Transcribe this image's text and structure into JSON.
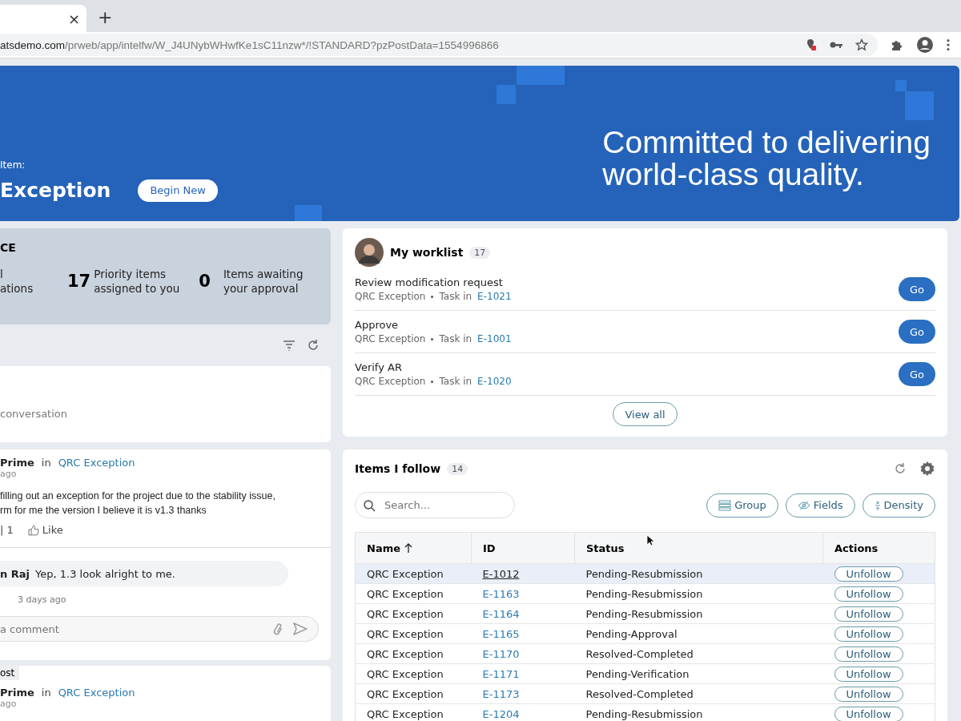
{
  "browser": {
    "tab_close": "×",
    "new_tab": "+",
    "url_host": "atsdemo.com",
    "url_path": "/prweb/app/intelfw/W_J4UNybWHwfKe1sC11nzw*/!STANDARD?pzPostData=1554996866"
  },
  "banner": {
    "label": "Item:",
    "title": "Exception",
    "button": "Begin New",
    "tagline": [
      "Committed to delivering",
      "world-class quality."
    ]
  },
  "stats": {
    "title": "CE",
    "items": [
      {
        "lines": [
          "l",
          "ations"
        ]
      },
      {
        "value": "17",
        "lines": [
          "Priority items",
          "assigned to you"
        ]
      },
      {
        "value": "0",
        "lines": [
          "Items awaiting",
          "your approval"
        ]
      }
    ]
  },
  "feed": {
    "prompt": "conversation",
    "post": {
      "author": "Prime",
      "in": "in",
      "context": "QRC Exception",
      "time": "ago",
      "message": [
        "filling out an exception for the project due to the stability issue,",
        "rm for me the version I believe it is v1.3 thanks"
      ],
      "count": "| 1",
      "like": "Like",
      "reply": {
        "author": "n Raj",
        "text": "Yep, 1.3 look alright to me.",
        "time": "3 days ago"
      },
      "comment_placeholder": "a comment"
    },
    "next": {
      "tag": "ost",
      "author": "Prime",
      "in": "in",
      "context": "QRC Exception",
      "time": "ago"
    }
  },
  "worklist": {
    "title": "My worklist",
    "count": "17",
    "items": [
      {
        "title": "Review modification request",
        "type": "QRC Exception",
        "task_label": "Task in",
        "id": "E-1021",
        "button": "Go"
      },
      {
        "title": "Approve",
        "type": "QRC Exception",
        "task_label": "Task in",
        "id": "E-1001",
        "button": "Go"
      },
      {
        "title": "Verify AR",
        "type": "QRC Exception",
        "task_label": "Task in",
        "id": "E-1020",
        "button": "Go"
      }
    ],
    "view_all": "View all"
  },
  "follow": {
    "title": "Items I follow",
    "count": "14",
    "search_placeholder": "Search...",
    "tools": [
      {
        "kind": "group",
        "label": "Group"
      },
      {
        "kind": "fields",
        "label": "Fields"
      },
      {
        "kind": "density",
        "label": "Density"
      }
    ],
    "columns": [
      {
        "label": "Name",
        "sorted": true
      },
      {
        "label": "ID",
        "sorted": false
      },
      {
        "label": "Status",
        "sorted": false
      },
      {
        "label": "Actions",
        "sorted": false
      }
    ],
    "rows": [
      {
        "name": "QRC Exception",
        "id": "E-1012",
        "status": "Pending-Resubmission",
        "action": "Unfollow",
        "selected": true
      },
      {
        "name": "QRC Exception",
        "id": "E-1163",
        "status": "Pending-Resubmission",
        "action": "Unfollow",
        "selected": false
      },
      {
        "name": "QRC Exception",
        "id": "E-1164",
        "status": "Pending-Resubmission",
        "action": "Unfollow",
        "selected": false
      },
      {
        "name": "QRC Exception",
        "id": "E-1165",
        "status": "Pending-Approval",
        "action": "Unfollow",
        "selected": false
      },
      {
        "name": "QRC Exception",
        "id": "E-1170",
        "status": "Resolved-Completed",
        "action": "Unfollow",
        "selected": false
      },
      {
        "name": "QRC Exception",
        "id": "E-1171",
        "status": "Pending-Verification",
        "action": "Unfollow",
        "selected": false
      },
      {
        "name": "QRC Exception",
        "id": "E-1173",
        "status": "Resolved-Completed",
        "action": "Unfollow",
        "selected": false
      },
      {
        "name": "QRC Exception",
        "id": "E-1204",
        "status": "Pending-Resubmission",
        "action": "Unfollow",
        "selected": false
      }
    ]
  }
}
